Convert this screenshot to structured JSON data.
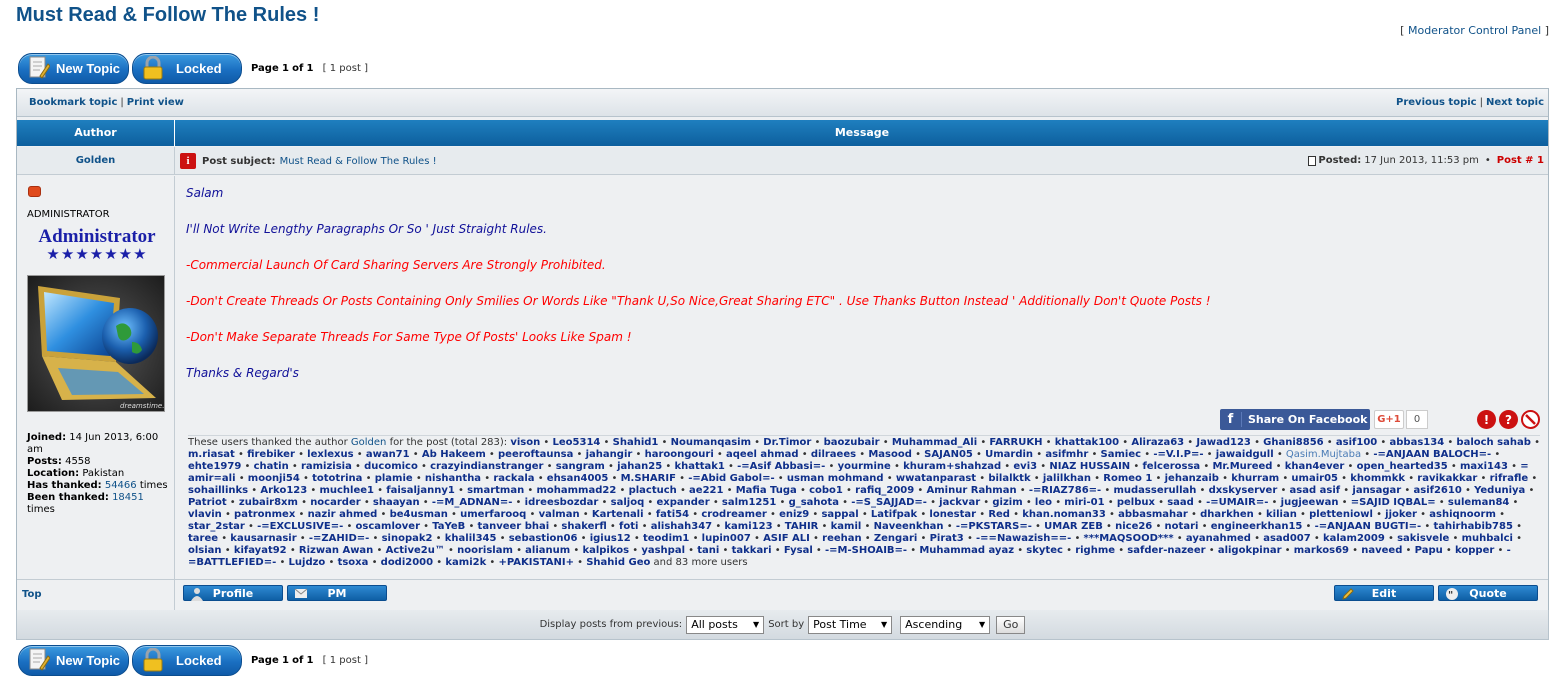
{
  "page": {
    "title": "Must Read & Follow The Rules !",
    "mcp_label": "Moderator Control Panel"
  },
  "toolbar": {
    "new_topic": "New Topic",
    "locked": "Locked",
    "page_prefix": "Page",
    "page_current": "1",
    "page_of": "of",
    "page_total": "1",
    "post_count": "[ 1 post ]"
  },
  "nav": {
    "bookmark": "Bookmark topic",
    "print": "Print view",
    "previous": "Previous topic",
    "next": "Next topic"
  },
  "table": {
    "author_header": "Author",
    "message_header": "Message"
  },
  "post": {
    "author": "Golden",
    "subject_label": "Post subject:",
    "subject": "Must Read & Follow The Rules !",
    "posted_label": "Posted:",
    "posted_date": "17 Jun 2013, 11:53 pm",
    "post_number": "Post # 1",
    "body": [
      {
        "text": "Salam",
        "color": "#111199"
      },
      {
        "text": "I'll Not Write Lengthy Paragraphs Or So ' Just Straight Rules.",
        "color": "#111199"
      },
      {
        "text": "-Commercial Launch Of Card Sharing Servers Are Strongly Prohibited.",
        "color": "#ff0000"
      },
      {
        "text": "-Don't Create Threads Or Posts Containing Only Smilies Or Words Like \"Thank U,So Nice,Great Sharing ETC\" . Use Thanks Button Instead ' Additionally Don't Quote Posts !",
        "color": "#ff0000"
      },
      {
        "text": "-Don't Make Separate Threads For Same Type Of Posts' Looks Like Spam !",
        "color": "#ff0000"
      },
      {
        "text": "Thanks & Regard's",
        "color": "#111199"
      }
    ]
  },
  "profile": {
    "rank": "ADMINISTRATOR",
    "rank_image_text": "Administrator",
    "rank_stars": "★★★★★★★",
    "avatar_credit": "dreamstime.com",
    "joined_label": "Joined:",
    "joined": "14 Jun 2013, 6:00 am",
    "posts_label": "Posts:",
    "posts": "4558",
    "location_label": "Location:",
    "location": "Pakistan",
    "has_thanked_label": "Has thanked:",
    "has_thanked": "54466",
    "has_thanked_suffix": "times",
    "been_thanked_label": "Been thanked:",
    "been_thanked": "18451",
    "been_thanked_suffix": "times"
  },
  "social": {
    "facebook_label": "Share On Facebook",
    "gplus_label": "G+1",
    "gplus_count": "0"
  },
  "thanks": {
    "prefix": "These users thanked the author",
    "author": "Golden",
    "suffix": "for the post (total 283):",
    "users": [
      "vison",
      "Leo5314",
      "Shahid1",
      "Noumanqasim",
      "Dr.Timor",
      "baozubair",
      "Muhammad_Ali",
      "FARRUKH",
      "khattak100",
      "Aliraza63",
      "Jawad123",
      "Ghani8856",
      "asif100",
      "abbas134",
      "baloch sahab",
      "m.riasat",
      "firebiker",
      "lexlexus",
      "awan71",
      "Ab Hakeem",
      "peeroftaunsa",
      "jahangir",
      "haroongouri",
      "aqeel ahmad",
      "dilraees",
      "Masood",
      "SAJAN05",
      "Umardin",
      "asifmhr",
      "Samiec",
      "-=V.I.P=-",
      "jawaidgull",
      "Qasim.Mujtaba",
      "-=ANJAAN BALOCH=-",
      "ehte1979",
      "chatin",
      "ramizisia",
      "ducomico",
      "crazyindianstranger",
      "sangram",
      "jahan25",
      "khattak1",
      "-=Asif Abbasi=-",
      "yourmine",
      "khuram+shahzad",
      "evi3",
      "NIAZ HUSSAIN",
      "felcerossa",
      "Mr.Mureed",
      "khan4ever",
      "open_hearted35",
      "maxi143",
      "= amir=ali",
      "moonji54",
      "tototrina",
      "plamie",
      "nishantha",
      "rackala",
      "ehsan4005",
      "M.SHARIF",
      "-=Abid Gabol=-",
      "usman mohmand",
      "wwatanparast",
      "bilalktk",
      "jalilkhan",
      "Romeo 1",
      "jehanzaib",
      "khurram",
      "umair05",
      "khommkk",
      "ravikakkar",
      "rifrafle",
      "sohaillinks",
      "Arko123",
      "muchlee1",
      "faisaljanny1",
      "smartman",
      "mohammad22",
      "plactuch",
      "ae221",
      "Mafia Tuga",
      "cobo1",
      "rafiq_2009",
      "Aminur Rahman",
      "-=RIAZ786=-",
      "mudasserullah",
      "dxskyserver",
      "asad asif",
      "jansagar",
      "asif2610",
      "Yeduniya",
      "Patriot",
      "zubair8xm",
      "nocarder",
      "shaayan",
      "-=M_ADNAN=-",
      "idreesbozdar",
      "saljoq",
      "expander",
      "salm1251",
      "g_sahota",
      "-=S_SAJJAD=-",
      "jackvar",
      "gizim",
      "leo",
      "miri-01",
      "pelbux",
      "saad",
      "-=UMAIR=-",
      "jugjeewan",
      "=SAJID IQBAL=",
      "suleman84",
      "vlavin",
      "patronmex",
      "nazir ahmed",
      "be4usman",
      "umerfarooq",
      "valman",
      "Kartenali",
      "fati54",
      "crodreamer",
      "eniz9",
      "sappal",
      "Latifpak",
      "lonestar",
      "Red",
      "khan.noman33",
      "abbasmahar",
      "dharkhen",
      "kilian",
      "pletteniowl",
      "jjoker",
      "ashiqnoorm",
      "star_2star",
      "-=EXCLUSIVE=-",
      "oscamlover",
      "TaYeB",
      "tanveer bhai",
      "shakerfl",
      "foti",
      "alishah347",
      "kami123",
      "TAHIR",
      "kamil",
      "Naveenkhan",
      "-=PKSTARS=-",
      "UMAR ZEB",
      "nice26",
      "notari",
      "engineerkhan15",
      "-=ANJAAN BUGTI=-",
      "tahirhabib785",
      "taree",
      "kausarnasir",
      "-=ZAHID=-",
      "sinopak2",
      "khalil345",
      "sebastion06",
      "igius12",
      "teodim1",
      "lupin007",
      "ASIF ALI",
      "reehan",
      "Zengari",
      "Pirat3",
      "-==Nawazish==-",
      "***MAQSOOD***",
      "ayanahmed",
      "asad007",
      "kalam2009",
      "sakisvele",
      "muhbalci",
      "olsian",
      "kifayat92",
      "Rizwan Awan",
      "Active2u™",
      "noorislam",
      "alianum",
      "kalpikos",
      "yashpal",
      "tani",
      "takkari",
      "Fysal",
      "-=M-SHOAIB=-",
      "Muhammad ayaz",
      "skytec",
      "righme",
      "safder-nazeer",
      "aligokpinar",
      "markos69",
      "naveed",
      "Papu",
      "kopper",
      "-=BATTLEFIED=-",
      "Lujdzo",
      "tsoxa",
      "dodi2000",
      "kami2k",
      "+PAKISTANI+",
      "Shahid Geo"
    ],
    "more": "and 83 more users"
  },
  "postfoot": {
    "top": "Top",
    "profile": "Profile",
    "pm": "PM",
    "edit": "Edit",
    "quote": "Quote"
  },
  "sortbar": {
    "display_label": "Display posts from previous:",
    "display_value": "All posts",
    "sort_label": "Sort by",
    "sort_value": "Post Time",
    "order_value": "Ascending",
    "go": "Go"
  }
}
